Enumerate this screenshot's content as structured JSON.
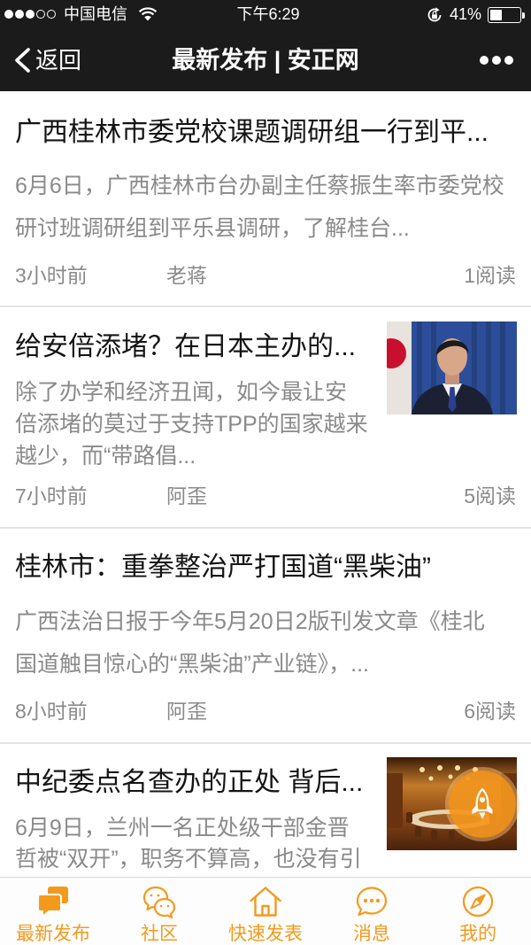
{
  "theme": {
    "accent": "#f39a1e",
    "dark": "#1b1b1b"
  },
  "status_bar": {
    "signal_bars": 3,
    "signal_max": 5,
    "carrier": "中国电信",
    "time": "下午6:29",
    "battery_text": "41%",
    "battery_level": 0.41
  },
  "nav": {
    "back_label": "返回",
    "title": "最新发布 | 安正网",
    "more_icon": "more-dots-icon"
  },
  "articles": [
    {
      "title": "广西桂林市委党校课题调研组一行到平...",
      "summary_lines": [
        "6月6日，广西桂林市台办副主任蔡振生率市委党校",
        "研讨班调研组到平乐县调研，了解桂台..."
      ],
      "time": "3小时前",
      "author": "老蒋",
      "reads": "1阅读"
    },
    {
      "title": "给安倍添堵？在日本主办的...",
      "summary_lines": [
        "除了办学和经济丑闻，如今最让安",
        "倍添堵的莫过于支持TPP的国家越来",
        "越少，而“带路倡..."
      ],
      "time": "7小时前",
      "author": "阿歪",
      "reads": "5阅读"
    },
    {
      "title": "桂林市：重拳整治严打国道“黑柴油”",
      "summary_lines": [
        "广西法治日报于今年5月20日2版刊发文章《桂北",
        "国道触目惊心的“黑柴油”产业链》，..."
      ],
      "time": "8小时前",
      "author": "阿歪",
      "reads": "6阅读"
    },
    {
      "title": "中纪委点名查办的正处 背后...",
      "summary_lines": [
        "6月9日，兰州一名正处级干部金晋",
        "哲被“双开”，职务不算高，也没有引"
      ]
    }
  ],
  "floating_button": {
    "icon": "rocket-icon"
  },
  "tab_bar": {
    "items": [
      {
        "label": "最新发布",
        "icon": "chat-bubbles-filled-icon",
        "active": true
      },
      {
        "label": "社区",
        "icon": "community-bubbles-icon",
        "active": false
      },
      {
        "label": "快速发表",
        "icon": "house-icon",
        "active": false
      },
      {
        "label": "消息",
        "icon": "message-dots-icon",
        "active": false
      },
      {
        "label": "我的",
        "icon": "compass-icon",
        "active": false
      }
    ]
  }
}
